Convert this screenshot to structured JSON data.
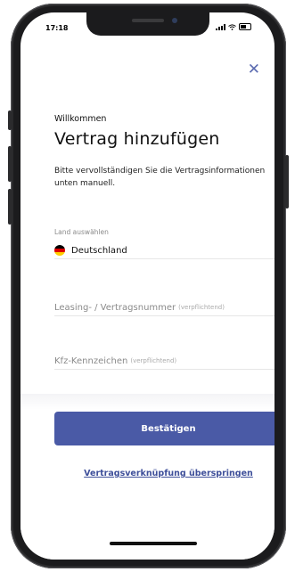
{
  "status_bar": {
    "time": "17:18"
  },
  "header": {
    "close_icon": "close-icon"
  },
  "main": {
    "welcome": "Willkommen",
    "title": "Vertrag hinzufügen",
    "description": "Bitte vervollständigen Sie die Vertragsinformationen unten manuell."
  },
  "country": {
    "label": "Land auswählen",
    "value": "Deutschland",
    "flag_icon": "germany-flag-icon"
  },
  "fields": {
    "contract_number": {
      "placeholder": "Leasing- / Vertragsnummer",
      "required": "(verpflichtend)"
    },
    "license_plate": {
      "placeholder": "Kfz-Kennzeichen",
      "required": "(verpflichtend)"
    }
  },
  "actions": {
    "confirm_label": "Bestätigen",
    "skip_label": "Vertragsverknüpfung überspringen"
  },
  "colors": {
    "accent": "#4a5aa6",
    "link": "#3e4f9a"
  }
}
